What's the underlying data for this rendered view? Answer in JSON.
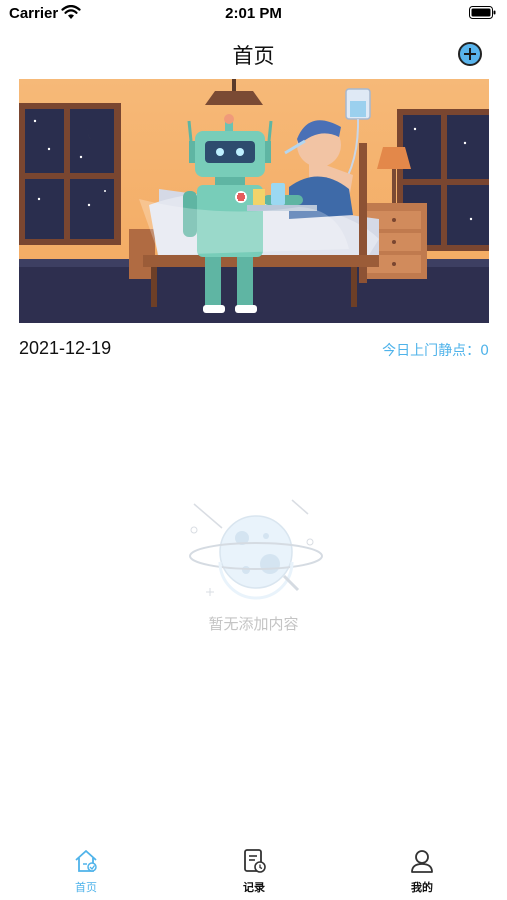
{
  "status_bar": {
    "carrier": "Carrier",
    "time": "2:01 PM"
  },
  "nav": {
    "title": "首页",
    "add_icon": "plus-circle-icon"
  },
  "banner": {
    "illustration": "robot-caring-for-sick-patient"
  },
  "summary": {
    "date": "2021-12-19",
    "visit_label": "今日上门静点：0"
  },
  "empty_state": {
    "icon": "planet-icon",
    "message": "暂无添加内容"
  },
  "tab_bar": {
    "tabs": [
      {
        "label": "首页",
        "icon": "home-icon",
        "active": true
      },
      {
        "label": "记录",
        "icon": "record-icon",
        "active": false
      },
      {
        "label": "我的",
        "icon": "profile-icon",
        "active": false
      }
    ]
  },
  "colors": {
    "accent": "#4fb3ea",
    "placeholder": "#c4c4c4"
  }
}
